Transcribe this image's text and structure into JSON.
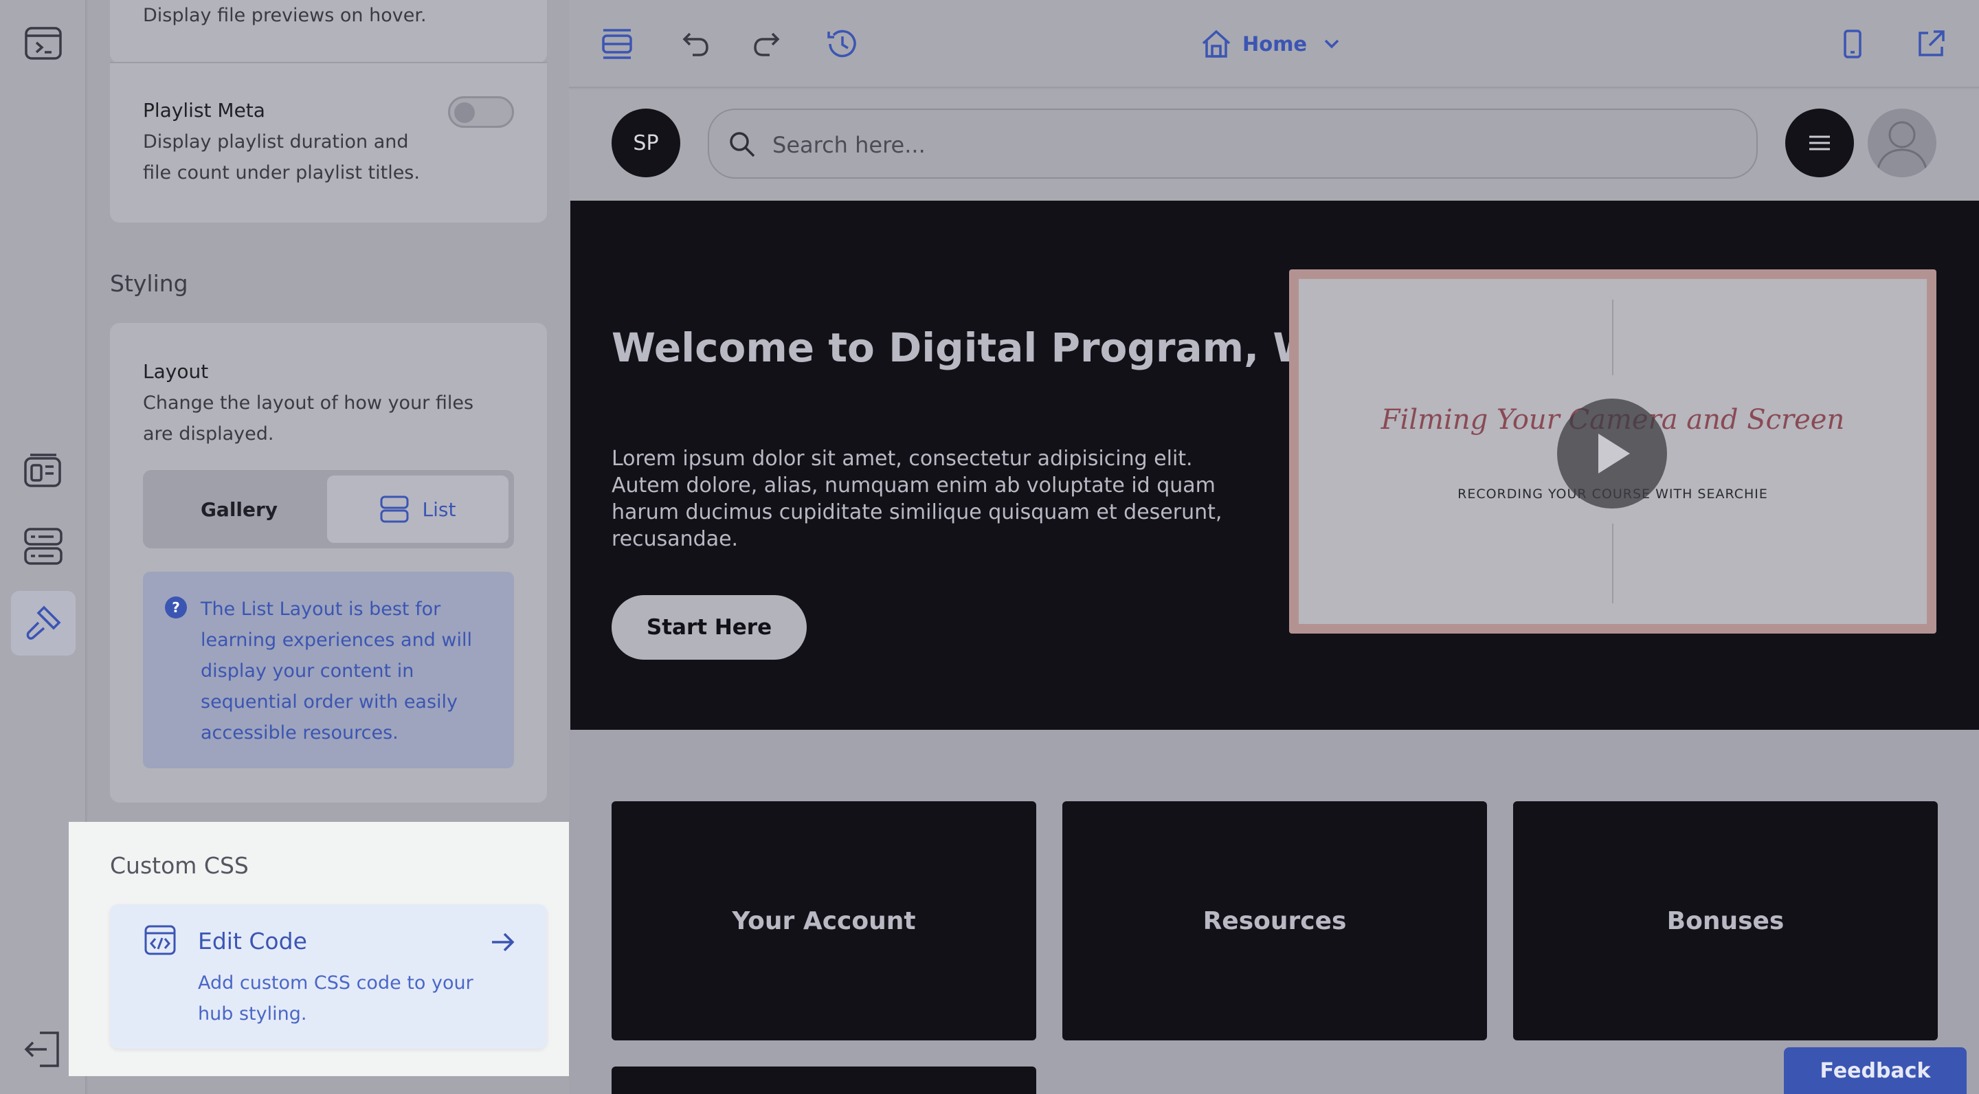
{
  "sidebar_panel": {
    "file_preview_desc": "Display file previews on hover.",
    "playlist_meta": {
      "title": "Playlist Meta",
      "desc": "Display playlist duration and file count under playlist titles.",
      "enabled": false
    },
    "styling_label": "Styling",
    "layout": {
      "title": "Layout",
      "desc": "Change the layout of how your files are displayed.",
      "options": [
        "Gallery",
        "List"
      ],
      "selected": "List",
      "info": "The List Layout is best for learning experiences and will display your content in sequential order with easily accessible resources."
    },
    "custom_css": {
      "label": "Custom CSS",
      "edit_title": "Edit Code",
      "edit_desc": "Add custom CSS code to your hub styling."
    }
  },
  "toolbar": {
    "page_select": "Home"
  },
  "hub": {
    "avatar_initials": "SP",
    "search_placeholder": "Search here...",
    "hero": {
      "title": "Welcome to Digital Program, Will",
      "body": "Lorem ipsum dolor sit amet, consectetur adipisicing elit. Autem dolore, alias, numquam enim ab voluptate id quam harum ducimus cupiditate similique quisquam et deserunt, recusandae.",
      "cta": "Start Here",
      "video_title": "Filming Your Camera and Screen",
      "video_subtitle": "RECORDING YOUR COURSE WITH SEARCHIE"
    },
    "tiles": [
      "Your Account",
      "Resources",
      "Bonuses"
    ]
  },
  "feedback_label": "Feedback",
  "colors": {
    "accent": "#3b55b3",
    "hero_bg": "#121118"
  }
}
